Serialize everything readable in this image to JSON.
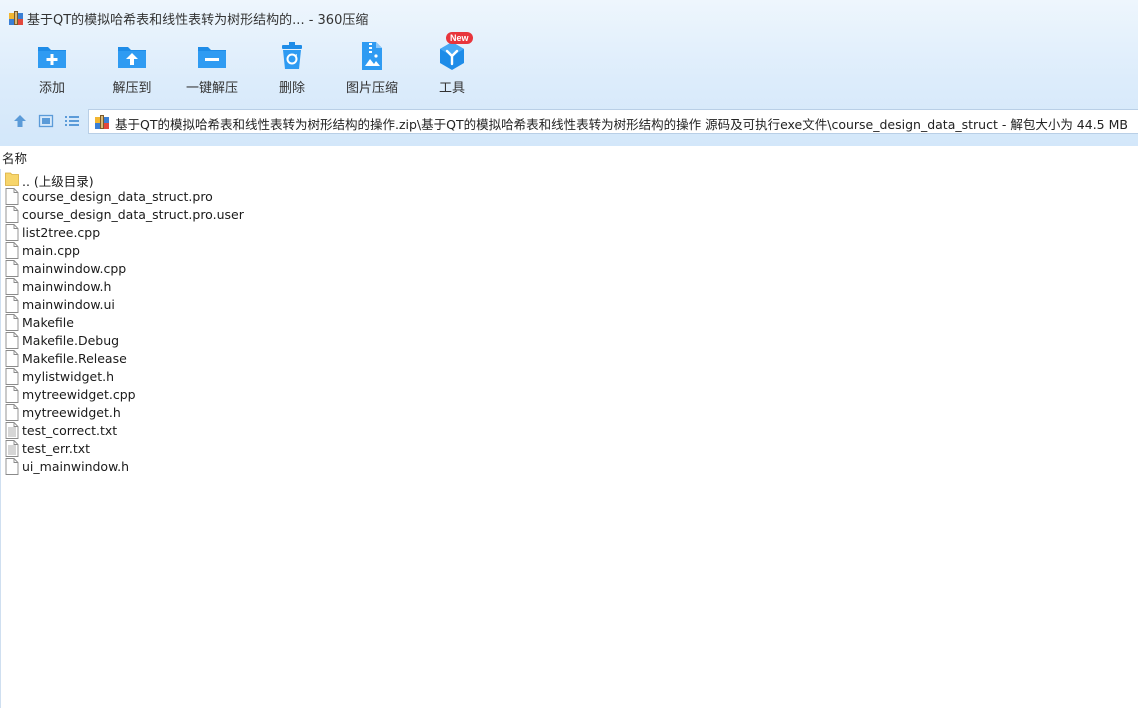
{
  "window": {
    "title": "基于QT的模拟哈希表和线性表转为树形结构的... - 360压缩"
  },
  "toolbar": {
    "items": [
      {
        "label": "添加",
        "icon": "add-folder-icon"
      },
      {
        "label": "解压到",
        "icon": "extract-to-icon"
      },
      {
        "label": "一键解压",
        "icon": "one-click-extract-icon"
      },
      {
        "label": "删除",
        "icon": "recycle-bin-icon"
      },
      {
        "label": "图片压缩",
        "icon": "image-compress-icon"
      },
      {
        "label": "工具",
        "icon": "tools-cube-icon",
        "badge": "New"
      }
    ]
  },
  "address": {
    "path": "基于QT的模拟哈希表和线性表转为树形结构的操作.zip\\基于QT的模拟哈希表和线性表转为树形结构的操作 源码及可执行exe文件\\course_design_data_struct - 解包大小为 44.5 MB"
  },
  "list": {
    "header_name": "名称",
    "items": [
      {
        "name": ".. (上级目录)",
        "type": "folder"
      },
      {
        "name": "course_design_data_struct.pro",
        "type": "file"
      },
      {
        "name": "course_design_data_struct.pro.user",
        "type": "file"
      },
      {
        "name": "list2tree.cpp",
        "type": "file"
      },
      {
        "name": "main.cpp",
        "type": "file"
      },
      {
        "name": "mainwindow.cpp",
        "type": "file"
      },
      {
        "name": "mainwindow.h",
        "type": "file"
      },
      {
        "name": "mainwindow.ui",
        "type": "file"
      },
      {
        "name": "Makefile",
        "type": "file"
      },
      {
        "name": "Makefile.Debug",
        "type": "file"
      },
      {
        "name": "Makefile.Release",
        "type": "file"
      },
      {
        "name": "mylistwidget.h",
        "type": "file"
      },
      {
        "name": "mytreewidget.cpp",
        "type": "file"
      },
      {
        "name": "mytreewidget.h",
        "type": "file"
      },
      {
        "name": "test_correct.txt",
        "type": "text"
      },
      {
        "name": "test_err.txt",
        "type": "text"
      },
      {
        "name": "ui_mainwindow.h",
        "type": "file"
      }
    ]
  },
  "colors": {
    "accent": "#1a8cf0",
    "chrome_bg": "#dcecfb",
    "badge": "#e8353c"
  }
}
